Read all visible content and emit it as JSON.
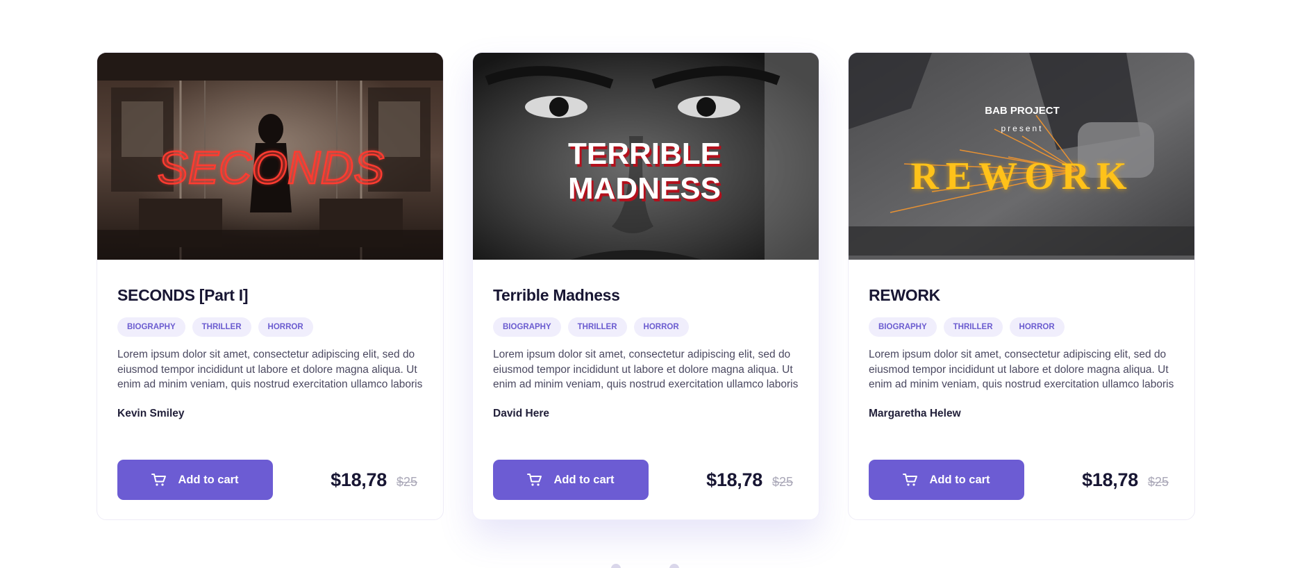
{
  "colors": {
    "accent": "#6c5cd3",
    "tag_background": "#f0eefc",
    "tag_text": "#6b5cd0",
    "heading": "#181633"
  },
  "products": [
    {
      "cover": {
        "title_text": "SECONDS",
        "title_color": "#ff3b30",
        "scene": "dark-train-interior-with-figure"
      },
      "title": "SECONDS [Part I]",
      "tags": [
        "BIOGRAPHY",
        "THRILLER",
        "HORROR"
      ],
      "description": "Lorem ipsum dolor sit amet, consectetur adipiscing elit, sed do eiusmod tempor incididunt ut labore et dolore magna aliqua. Ut enim ad minim veniam, quis nostrud exercitation ullamco laboris",
      "author": "Kevin Smiley",
      "cart_label": "Add to cart",
      "cart_icon": "cart-icon",
      "price": "$18,78",
      "old_price": "$25"
    },
    {
      "cover": {
        "title_line1": "TERRIBLE",
        "title_line2": "MADNESS",
        "title_color": "#ffffff",
        "shadow_color": "#b3101c",
        "scene": "black-and-white-face-closeup"
      },
      "title": "Terrible Madness",
      "tags": [
        "BIOGRAPHY",
        "THRILLER",
        "HORROR"
      ],
      "description": "Lorem ipsum dolor sit amet, consectetur adipiscing elit, sed do eiusmod tempor incididunt ut labore et dolore magna aliqua. Ut enim ad minim veniam, quis nostrud exercitation ullamco laboris",
      "author": "David Here",
      "cart_label": "Add to cart",
      "cart_icon": "cart-icon",
      "price": "$18,78",
      "old_price": "$25"
    },
    {
      "cover": {
        "kicker": "BAB PROJECT",
        "subkicker": "present",
        "title_text": "REWORK",
        "title_color": "#ffc21a",
        "scene": "metal-grinder-sparks"
      },
      "title": "REWORK",
      "tags": [
        "BIOGRAPHY",
        "THRILLER",
        "HORROR"
      ],
      "description": "Lorem ipsum dolor sit amet, consectetur adipiscing elit, sed do eiusmod tempor incididunt ut labore et dolore magna aliqua. Ut enim ad minim veniam, quis nostrud exercitation ullamco laboris",
      "author": "Margaretha Helew",
      "cart_label": "Add to cart",
      "cart_icon": "cart-icon",
      "price": "$18,78",
      "old_price": "$25"
    }
  ]
}
